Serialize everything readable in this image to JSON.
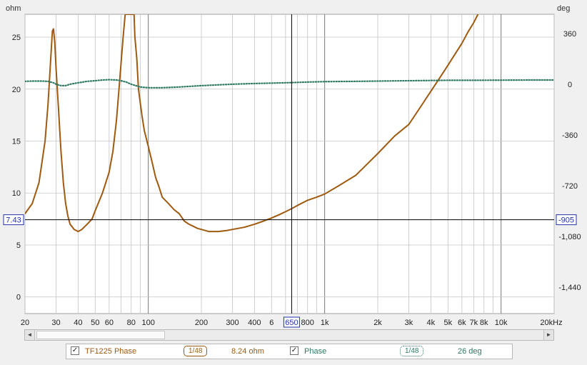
{
  "chart_data": {
    "type": "line",
    "ylabel_left": "ohm",
    "ylabel_right": "deg",
    "x_unit": "Hz",
    "xlim": [
      20,
      20000
    ],
    "x_scale": "log",
    "ylim_left": [
      -1.6,
      27.2
    ],
    "ylim_right": [
      -1627,
      496
    ],
    "x_tick_labels": [
      {
        "v": 20,
        "t": "20"
      },
      {
        "v": 30,
        "t": "30"
      },
      {
        "v": 40,
        "t": "40"
      },
      {
        "v": 50,
        "t": "50"
      },
      {
        "v": 60,
        "t": "60"
      },
      {
        "v": 80,
        "t": "80"
      },
      {
        "v": 100,
        "t": "100"
      },
      {
        "v": 200,
        "t": "200"
      },
      {
        "v": 300,
        "t": "300"
      },
      {
        "v": 400,
        "t": "400"
      },
      {
        "v": 500,
        "t": "6"
      },
      {
        "v": 800,
        "t": "800"
      },
      {
        "v": 1000,
        "t": "1k"
      },
      {
        "v": 2000,
        "t": "2k"
      },
      {
        "v": 3000,
        "t": "3k"
      },
      {
        "v": 4000,
        "t": "4k"
      },
      {
        "v": 5000,
        "t": "5k"
      },
      {
        "v": 6000,
        "t": "6k"
      },
      {
        "v": 7000,
        "t": "7k"
      },
      {
        "v": 8000,
        "t": "8k"
      },
      {
        "v": 10000,
        "t": "10k"
      },
      {
        "v": 20000,
        "t": "20kHz"
      }
    ],
    "y_ticks_left": [
      0,
      5,
      10,
      15,
      20,
      25
    ],
    "y_tick_labels_right": [
      {
        "v": 360,
        "t": "360"
      },
      {
        "v": 0,
        "t": "0"
      },
      {
        "v": -360,
        "t": "-360"
      },
      {
        "v": -720,
        "t": "-720"
      },
      {
        "v": -1080,
        "t": "-1,080"
      },
      {
        "v": -1440,
        "t": "-1,440"
      }
    ],
    "grid": true,
    "legend": "bottom",
    "cursor": {
      "x": 650,
      "x_label": "650",
      "y_left": 7.43,
      "y_left_label": "7.43",
      "y_right_label": "-905"
    },
    "series": [
      {
        "name": "TF1225 Phase",
        "axis": "left",
        "color": "#a05a10",
        "style": "solid",
        "points": [
          [
            20,
            8.0
          ],
          [
            22,
            9.0
          ],
          [
            24,
            11.0
          ],
          [
            26,
            15.0
          ],
          [
            27,
            18.5
          ],
          [
            28,
            23.0
          ],
          [
            28.6,
            25.6
          ],
          [
            29,
            25.8
          ],
          [
            29.5,
            24.5
          ],
          [
            30,
            22.0
          ],
          [
            31,
            18.0
          ],
          [
            32,
            14.0
          ],
          [
            33,
            11.0
          ],
          [
            34,
            9.0
          ],
          [
            35,
            7.8
          ],
          [
            36,
            7.0
          ],
          [
            38,
            6.5
          ],
          [
            40,
            6.3
          ],
          [
            42,
            6.5
          ],
          [
            45,
            7.0
          ],
          [
            48,
            7.5
          ],
          [
            50,
            8.3
          ],
          [
            55,
            10.0
          ],
          [
            60,
            12.0
          ],
          [
            63,
            14.0
          ],
          [
            66,
            17.0
          ],
          [
            69,
            21.0
          ],
          [
            72,
            25.0
          ],
          [
            74,
            27.2
          ],
          [
            83,
            27.2
          ],
          [
            84,
            25.0
          ],
          [
            86,
            23.0
          ],
          [
            88,
            20.0
          ],
          [
            92,
            17.5
          ],
          [
            95,
            16.0
          ],
          [
            100,
            14.5
          ],
          [
            105,
            13.0
          ],
          [
            110,
            11.5
          ],
          [
            115,
            10.6
          ],
          [
            120,
            9.6
          ],
          [
            130,
            9.0
          ],
          [
            140,
            8.4
          ],
          [
            150,
            8.0
          ],
          [
            160,
            7.3
          ],
          [
            170,
            7.0
          ],
          [
            180,
            6.8
          ],
          [
            190,
            6.6
          ],
          [
            200,
            6.5
          ],
          [
            220,
            6.3
          ],
          [
            250,
            6.3
          ],
          [
            280,
            6.4
          ],
          [
            300,
            6.5
          ],
          [
            350,
            6.7
          ],
          [
            400,
            7.0
          ],
          [
            450,
            7.3
          ],
          [
            500,
            7.6
          ],
          [
            550,
            7.9
          ],
          [
            600,
            8.2
          ],
          [
            650,
            8.5
          ],
          [
            700,
            8.8
          ],
          [
            800,
            9.3
          ],
          [
            900,
            9.6
          ],
          [
            1000,
            9.9
          ],
          [
            1200,
            10.7
          ],
          [
            1500,
            11.7
          ],
          [
            2000,
            13.8
          ],
          [
            2500,
            15.5
          ],
          [
            3000,
            16.6
          ],
          [
            3500,
            18.3
          ],
          [
            4000,
            19.8
          ],
          [
            4500,
            21.1
          ],
          [
            5000,
            22.3
          ],
          [
            5500,
            23.4
          ],
          [
            6000,
            24.4
          ],
          [
            6500,
            25.5
          ],
          [
            7000,
            26.4
          ],
          [
            7400,
            27.2
          ]
        ]
      },
      {
        "name": "Phase",
        "axis": "right",
        "color": "#2e7a64",
        "style": "dotted",
        "points": [
          [
            20,
            20
          ],
          [
            22,
            22
          ],
          [
            25,
            22
          ],
          [
            27,
            20
          ],
          [
            29,
            10
          ],
          [
            30,
            0
          ],
          [
            32,
            -10
          ],
          [
            34,
            -10
          ],
          [
            36,
            0
          ],
          [
            40,
            10
          ],
          [
            45,
            20
          ],
          [
            50,
            25
          ],
          [
            55,
            30
          ],
          [
            60,
            32
          ],
          [
            66,
            30
          ],
          [
            70,
            25
          ],
          [
            75,
            15
          ],
          [
            80,
            0
          ],
          [
            85,
            -10
          ],
          [
            90,
            -20
          ],
          [
            100,
            -25
          ],
          [
            120,
            -25
          ],
          [
            150,
            -20
          ],
          [
            200,
            -10
          ],
          [
            300,
            0
          ],
          [
            400,
            5
          ],
          [
            600,
            10
          ],
          [
            800,
            15
          ],
          [
            1000,
            18
          ],
          [
            1500,
            20
          ],
          [
            2000,
            22
          ],
          [
            3000,
            25
          ],
          [
            5000,
            28
          ],
          [
            7000,
            28
          ],
          [
            10000,
            29
          ],
          [
            15000,
            30
          ],
          [
            20000,
            30
          ]
        ]
      }
    ]
  },
  "scrollbar": {
    "left_arrow": "◄",
    "right_arrow": "►"
  },
  "legend": {
    "items": [
      {
        "check": "✓",
        "name": "TF1225 Phase",
        "smoothing": "1/48",
        "value": "8.24 ohm",
        "color": "#a05a10"
      },
      {
        "check": "✓",
        "name": "Phase",
        "smoothing": "1/48",
        "value": "26 deg",
        "color": "#2e7a64"
      }
    ]
  }
}
